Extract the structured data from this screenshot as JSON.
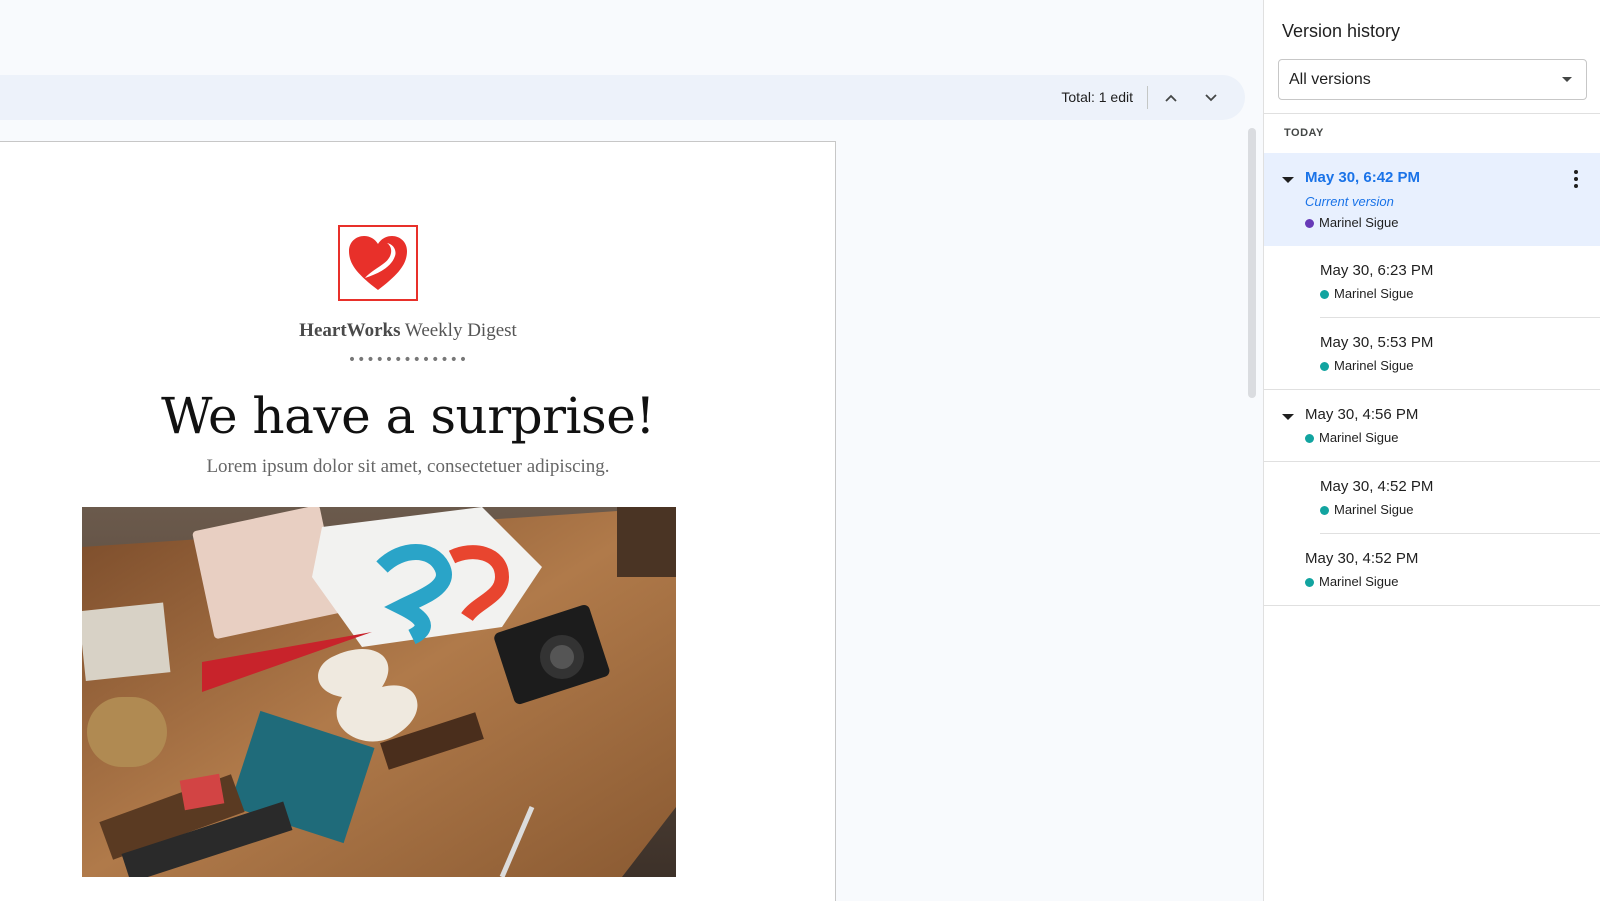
{
  "toolbar": {
    "total_edits": "Total: 1 edit",
    "prev_icon": "chevron-up-icon",
    "next_icon": "chevron-down-icon"
  },
  "document": {
    "brand_bold": "HeartWorks",
    "brand_rest": " Weekly Digest",
    "divider": "•••••••••••••",
    "headline": "We have a surprise!",
    "subheadline": "Lorem ipsum dolor sit amet, consectetuer adipiscing.",
    "logo_icon": "heart-icon",
    "accent_color": "#e8302a"
  },
  "version_panel": {
    "title": "Version history",
    "filter": {
      "selected": "All versions"
    },
    "group_label": "TODAY",
    "versions": [
      {
        "time": "May 30, 6:42 PM",
        "note": "Current version",
        "author": "Marinel Sigue",
        "dot_color": "#673ab7",
        "selected": true,
        "expanded": true
      },
      {
        "time": "May 30, 6:23 PM",
        "author": "Marinel Sigue",
        "dot_color": "#12a4a0"
      },
      {
        "time": "May 30, 5:53 PM",
        "author": "Marinel Sigue",
        "dot_color": "#12a4a0"
      },
      {
        "time": "May 30, 4:56 PM",
        "author": "Marinel Sigue",
        "dot_color": "#12a4a0",
        "expanded": true
      },
      {
        "time": "May 30, 4:52 PM",
        "author": "Marinel Sigue",
        "dot_color": "#12a4a0"
      },
      {
        "time": "May 30, 4:52 PM",
        "author": "Marinel Sigue",
        "dot_color": "#12a4a0"
      }
    ]
  }
}
